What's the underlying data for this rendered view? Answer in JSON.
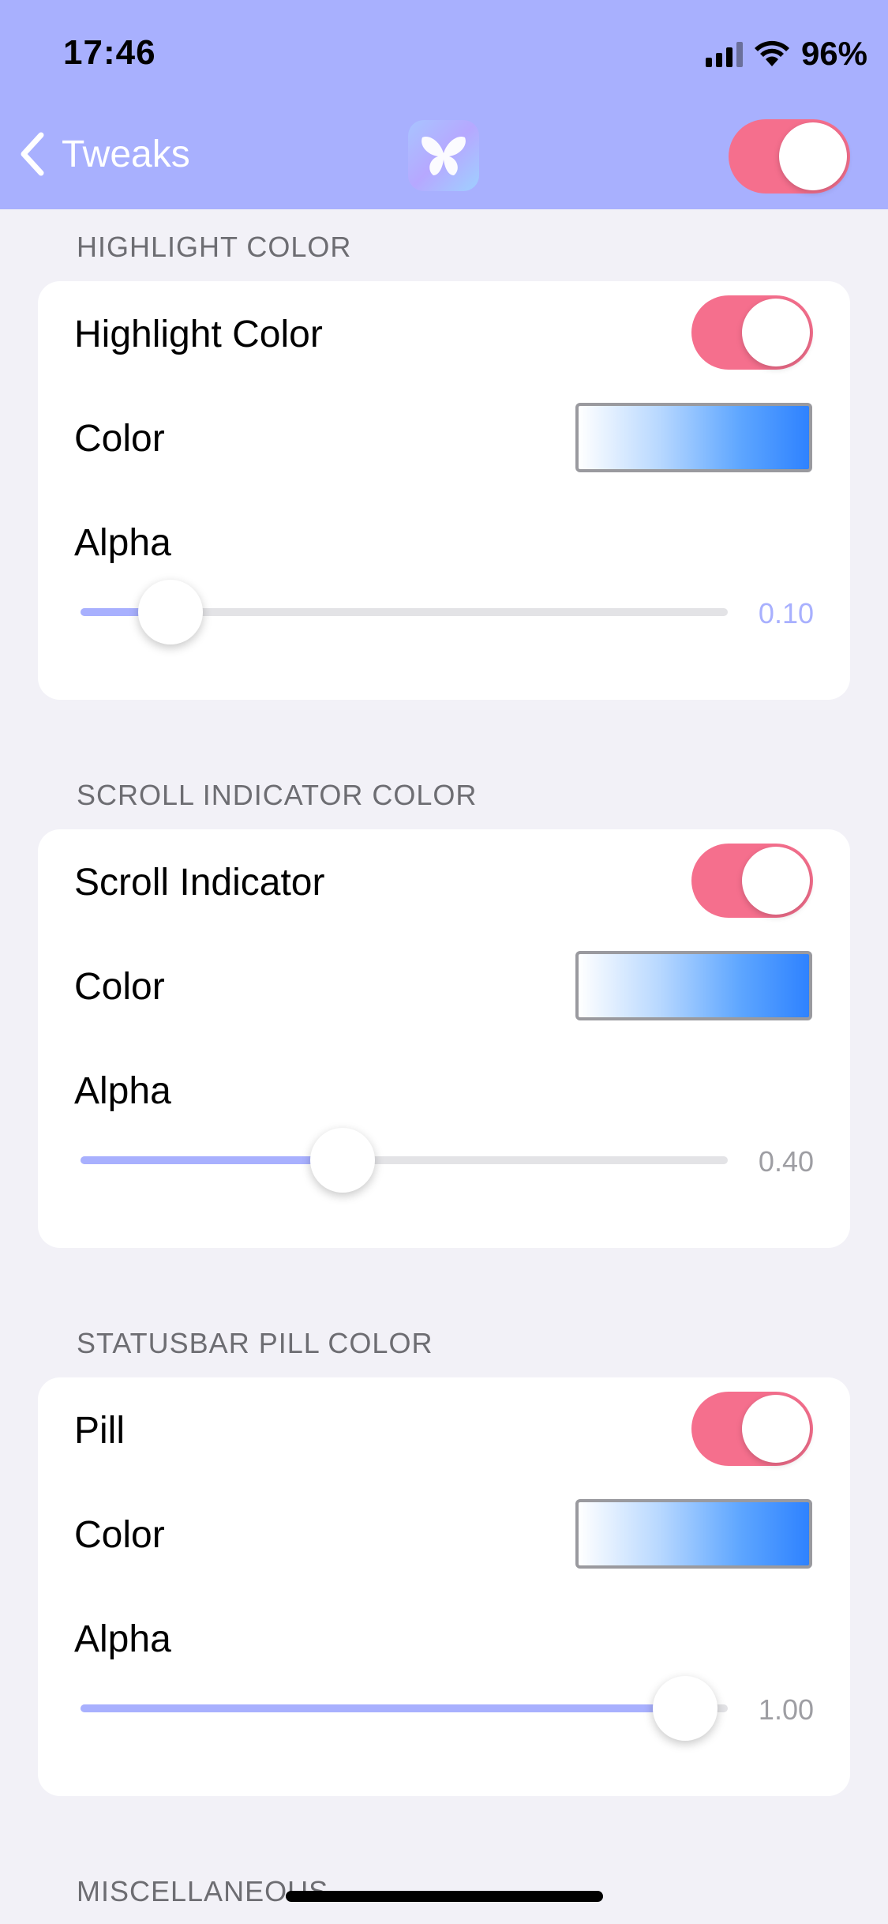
{
  "status_bar": {
    "time": "17:46",
    "battery": "96%"
  },
  "nav": {
    "back_label": "Tweaks",
    "enabled": true
  },
  "colors": {
    "accent": "#a8b0fe",
    "toggle_on": "#f56f8d",
    "background": "#f2f1f7"
  },
  "sections": [
    {
      "header": "HIGHLIGHT COLOR",
      "toggle_label": "Highlight Color",
      "toggle_on": true,
      "color_label": "Color",
      "alpha_label": "Alpha",
      "alpha_value": 0.1,
      "alpha_text": "0.10"
    },
    {
      "header": "SCROLL INDICATOR COLOR",
      "toggle_label": "Scroll Indicator",
      "toggle_on": true,
      "color_label": "Color",
      "alpha_label": "Alpha",
      "alpha_value": 0.4,
      "alpha_text": "0.40"
    },
    {
      "header": "STATUSBAR PILL COLOR",
      "toggle_label": "Pill",
      "toggle_on": true,
      "color_label": "Color",
      "alpha_label": "Alpha",
      "alpha_value": 1.0,
      "alpha_text": "1.00"
    }
  ],
  "footer_section_header": "MISCELLANEOUS"
}
